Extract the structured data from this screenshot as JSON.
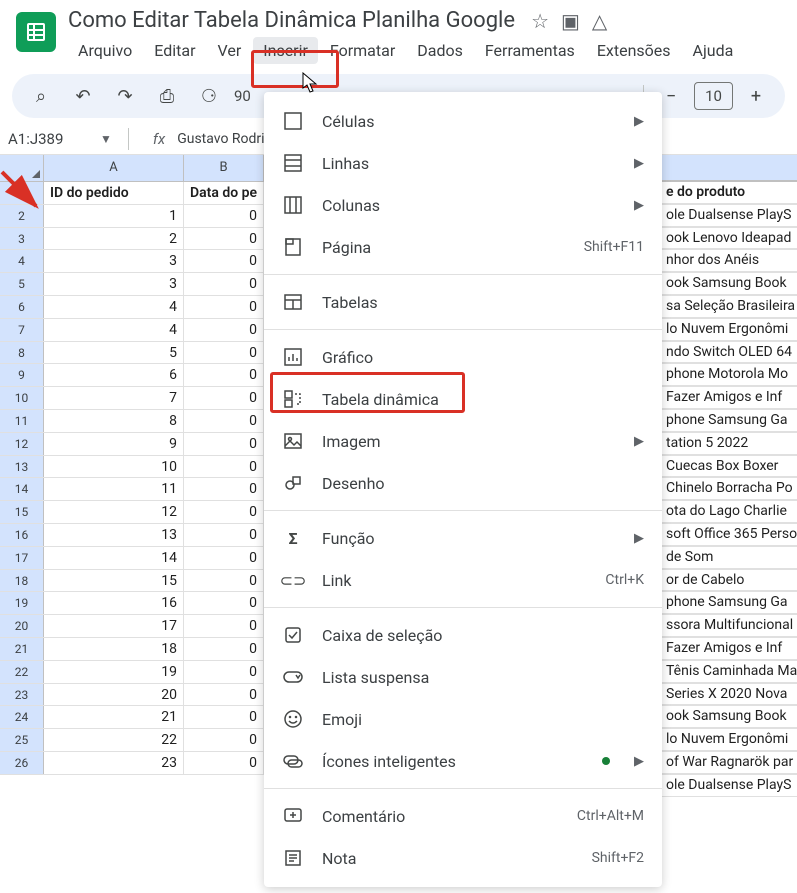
{
  "doc_title": "Como Editar Tabela Dinâmica Planilha Google",
  "menubar": [
    "Arquivo",
    "Editar",
    "Ver",
    "Inserir",
    "Formatar",
    "Dados",
    "Ferramentas",
    "Extensões",
    "Ajuda"
  ],
  "toolbar": {
    "zoom_preview": "90",
    "font_size": "10"
  },
  "namebox": "A1:J389",
  "formula": "Gustavo Rodri",
  "columns": [
    "A",
    "B"
  ],
  "headers": {
    "a": "ID do pedido",
    "b": "Data do pe",
    "right": "e do produto"
  },
  "rows_a": [
    "1",
    "2",
    "3",
    "3",
    "4",
    "4",
    "5",
    "6",
    "7",
    "8",
    "9",
    "10",
    "11",
    "12",
    "13",
    "14",
    "15",
    "16",
    "17",
    "18",
    "19",
    "20",
    "21",
    "22",
    "23"
  ],
  "rows_b": [
    "0",
    "0",
    "0",
    "0",
    "0",
    "0",
    "0",
    "0",
    "0",
    "0",
    "0",
    "0",
    "0",
    "0",
    "0",
    "0",
    "0",
    "0",
    "0",
    "0",
    "0",
    "0",
    "0",
    "0",
    "0"
  ],
  "right_rows": [
    "ole Dualsense PlayS",
    "ook Lenovo Ideapad",
    "nhor dos Anéis",
    "ook Samsung Book",
    "sa Seleção Brasileira",
    "lo Nuvem Ergonômi",
    "ndo Switch OLED 64",
    "phone Motorola Mo",
    "Fazer Amigos e Inf",
    "phone Samsung Ga",
    "tation 5 2022",
    "Cuecas Box Boxer",
    "Chinelo Borracha Po",
    "ota do Lago Charlie",
    "soft Office 365 Perso",
    "de Som",
    "or de Cabelo",
    "phone Samsung Ga",
    "ssora Multifuncional",
    "Fazer Amigos e Inf",
    "Tênis Caminhada Ma",
    "Series X 2020 Nova",
    "ook Samsung Book",
    "lo Nuvem Ergonômi",
    "of War Ragnarök par",
    "ole Dualsense PlayS"
  ],
  "dropdown": {
    "cells": "Células",
    "rows": "Linhas",
    "columns": "Colunas",
    "page": "Página",
    "page_shortcut": "Shift+F11",
    "tables": "Tabelas",
    "chart": "Gráfico",
    "pivot": "Tabela dinâmica",
    "image": "Imagem",
    "drawing": "Desenho",
    "function": "Função",
    "link": "Link",
    "link_shortcut": "Ctrl+K",
    "checkbox": "Caixa de seleção",
    "dropdown_list": "Lista suspensa",
    "emoji": "Emoji",
    "smart_chips": "Ícones inteligentes",
    "comment": "Comentário",
    "comment_shortcut": "Ctrl+Alt+M",
    "note": "Nota",
    "note_shortcut": "Shift+F2"
  }
}
